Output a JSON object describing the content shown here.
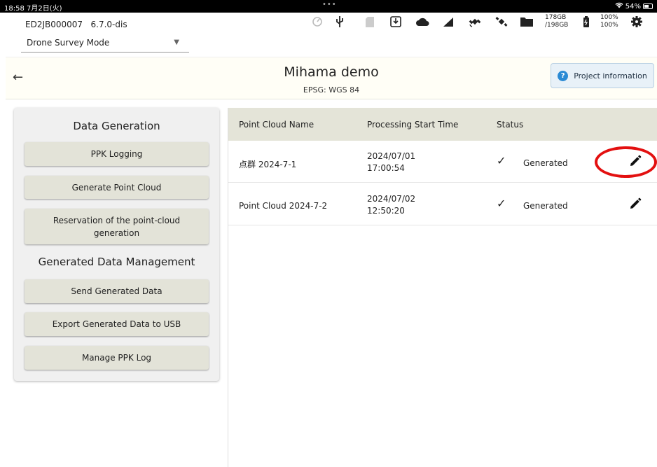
{
  "status_bar": {
    "time": "18:58 7月2日(火)",
    "dots": "•••",
    "battery": "54%"
  },
  "device": {
    "id": "ED2JB000007",
    "version": "6.7.0-dis",
    "mode": "Drone Survey Mode"
  },
  "header_icons": [
    "gauge-icon",
    "usb-icon",
    "sd-card-icon",
    "download-box-icon",
    "cloud-icon",
    "signal-icon",
    "satellite-icon",
    "folder-icon",
    "battery-icon",
    "gear-icon"
  ],
  "storage": {
    "used": "178GB",
    "total": "/198GB"
  },
  "battery_levels": {
    "top": "100%",
    "bottom": "100%"
  },
  "project": {
    "title": "Mihama demo",
    "epsg": "EPSG: WGS 84",
    "info_button": "Project information"
  },
  "left_panel": {
    "data_generation_title": "Data Generation",
    "ppk_logging": "PPK Logging",
    "generate_point_cloud": "Generate Point Cloud",
    "reservation_line1": "Reservation of the point-cloud",
    "reservation_line2": "generation",
    "management_title": "Generated Data Management",
    "send_generated_data": "Send Generated Data",
    "export_usb": "Export Generated Data to USB",
    "manage_ppk_log": "Manage PPK Log"
  },
  "table": {
    "headers": {
      "name": "Point Cloud Name",
      "time": "Processing Start Time",
      "status": "Status"
    },
    "rows": [
      {
        "name": "点群 2024-7-1",
        "date": "2024/07/01",
        "time": "17:00:54",
        "status": "Generated"
      },
      {
        "name": "Point Cloud 2024-7-2",
        "date": "2024/07/02",
        "time": "12:50:20",
        "status": "Generated"
      }
    ]
  },
  "colors": {
    "annotation": "#e31010",
    "accent": "#2a8ad4",
    "header_bg": "#e4e4d8"
  }
}
